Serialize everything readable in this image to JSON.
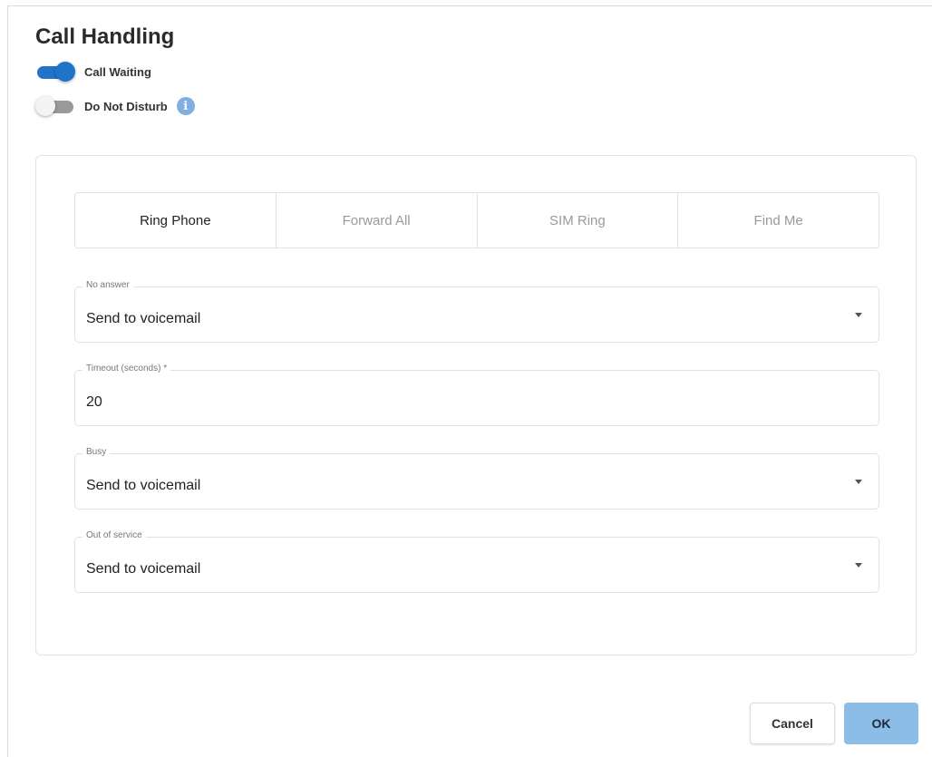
{
  "dialog": {
    "title": "Call Handling",
    "toggles": [
      {
        "label": "Call Waiting",
        "state": "on"
      },
      {
        "label": "Do Not Disturb",
        "state": "off"
      }
    ],
    "info_icon": "info-icon"
  },
  "tabs": [
    {
      "label": "Ring Phone",
      "active": true
    },
    {
      "label": "Forward All",
      "active": false
    },
    {
      "label": "SIM Ring",
      "active": false
    },
    {
      "label": "Find Me",
      "active": false
    }
  ],
  "fields": {
    "no_answer": {
      "label": "No answer",
      "value": "Send to voicemail"
    },
    "timeout": {
      "label": "Timeout (seconds) *",
      "value": "20"
    },
    "busy": {
      "label": "Busy",
      "value": "Send to voicemail"
    },
    "out_of_service": {
      "label": "Out of service",
      "value": "Send to voicemail"
    }
  },
  "buttons": {
    "cancel": "Cancel",
    "ok": "OK"
  },
  "colors": {
    "accent": "#1f74c9",
    "ok_button": "#8cbde7",
    "info_icon": "#7fb0e0"
  }
}
